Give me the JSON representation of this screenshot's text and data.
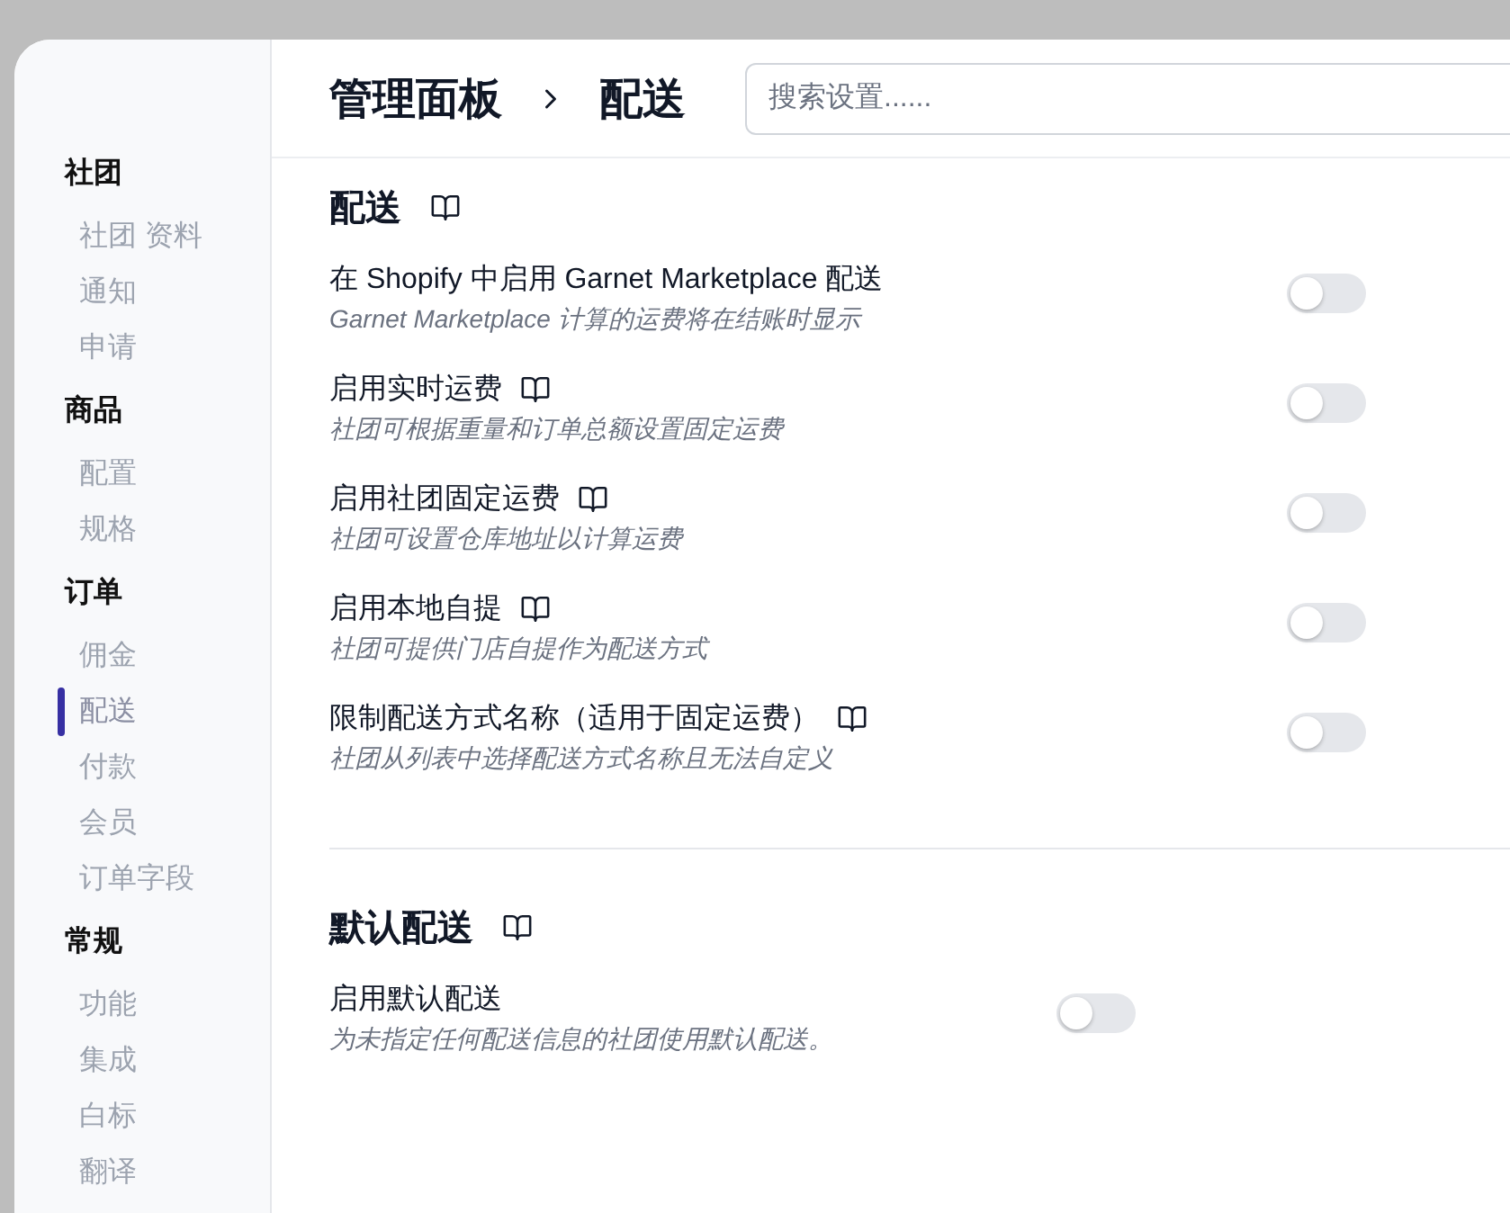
{
  "sidebar": {
    "groups": [
      {
        "label": "社团",
        "items": [
          {
            "label": "社团 资料",
            "selected": false
          },
          {
            "label": "通知",
            "selected": false
          },
          {
            "label": "申请",
            "selected": false
          }
        ]
      },
      {
        "label": "商品",
        "items": [
          {
            "label": "配置",
            "selected": false
          },
          {
            "label": "规格",
            "selected": false
          }
        ]
      },
      {
        "label": "订单",
        "items": [
          {
            "label": "佣金",
            "selected": false
          },
          {
            "label": "配送",
            "selected": true
          },
          {
            "label": "付款",
            "selected": false
          },
          {
            "label": "会员",
            "selected": false
          },
          {
            "label": "订单字段",
            "selected": false
          }
        ]
      },
      {
        "label": "常规",
        "items": [
          {
            "label": "功能",
            "selected": false
          },
          {
            "label": "集成",
            "selected": false
          },
          {
            "label": "白标",
            "selected": false
          },
          {
            "label": "翻译",
            "selected": false
          }
        ]
      }
    ]
  },
  "header": {
    "breadcrumb": [
      "管理面板",
      "配送"
    ],
    "search": {
      "placeholder": "搜索设置......"
    }
  },
  "sections": [
    {
      "title": "配送",
      "settings": [
        {
          "label": "在 Shopify 中启用 Garnet Marketplace 配送",
          "description": "Garnet Marketplace 计算的运费将在结账时显示",
          "guide_link": false,
          "on": false
        },
        {
          "label": "启用实时运费",
          "description": "社团可根据重量和订单总额设置固定运费",
          "guide_link": true,
          "on": false
        },
        {
          "label": "启用社团固定运费",
          "description": "社团可设置仓库地址以计算运费",
          "guide_link": true,
          "on": false
        },
        {
          "label": "启用本地自提",
          "description": "社团可提供门店自提作为配送方式",
          "guide_link": true,
          "on": false
        },
        {
          "label": "限制配送方式名称（适用于固定运费）",
          "description": "社团从列表中选择配送方式名称且无法自定义",
          "guide_link": true,
          "on": false
        }
      ]
    },
    {
      "title": "默认配送",
      "settings": [
        {
          "label": "启用默认配送",
          "description": "为未指定任何配送信息的社团使用默认配送。",
          "guide_link": false,
          "on": false
        }
      ]
    }
  ]
}
